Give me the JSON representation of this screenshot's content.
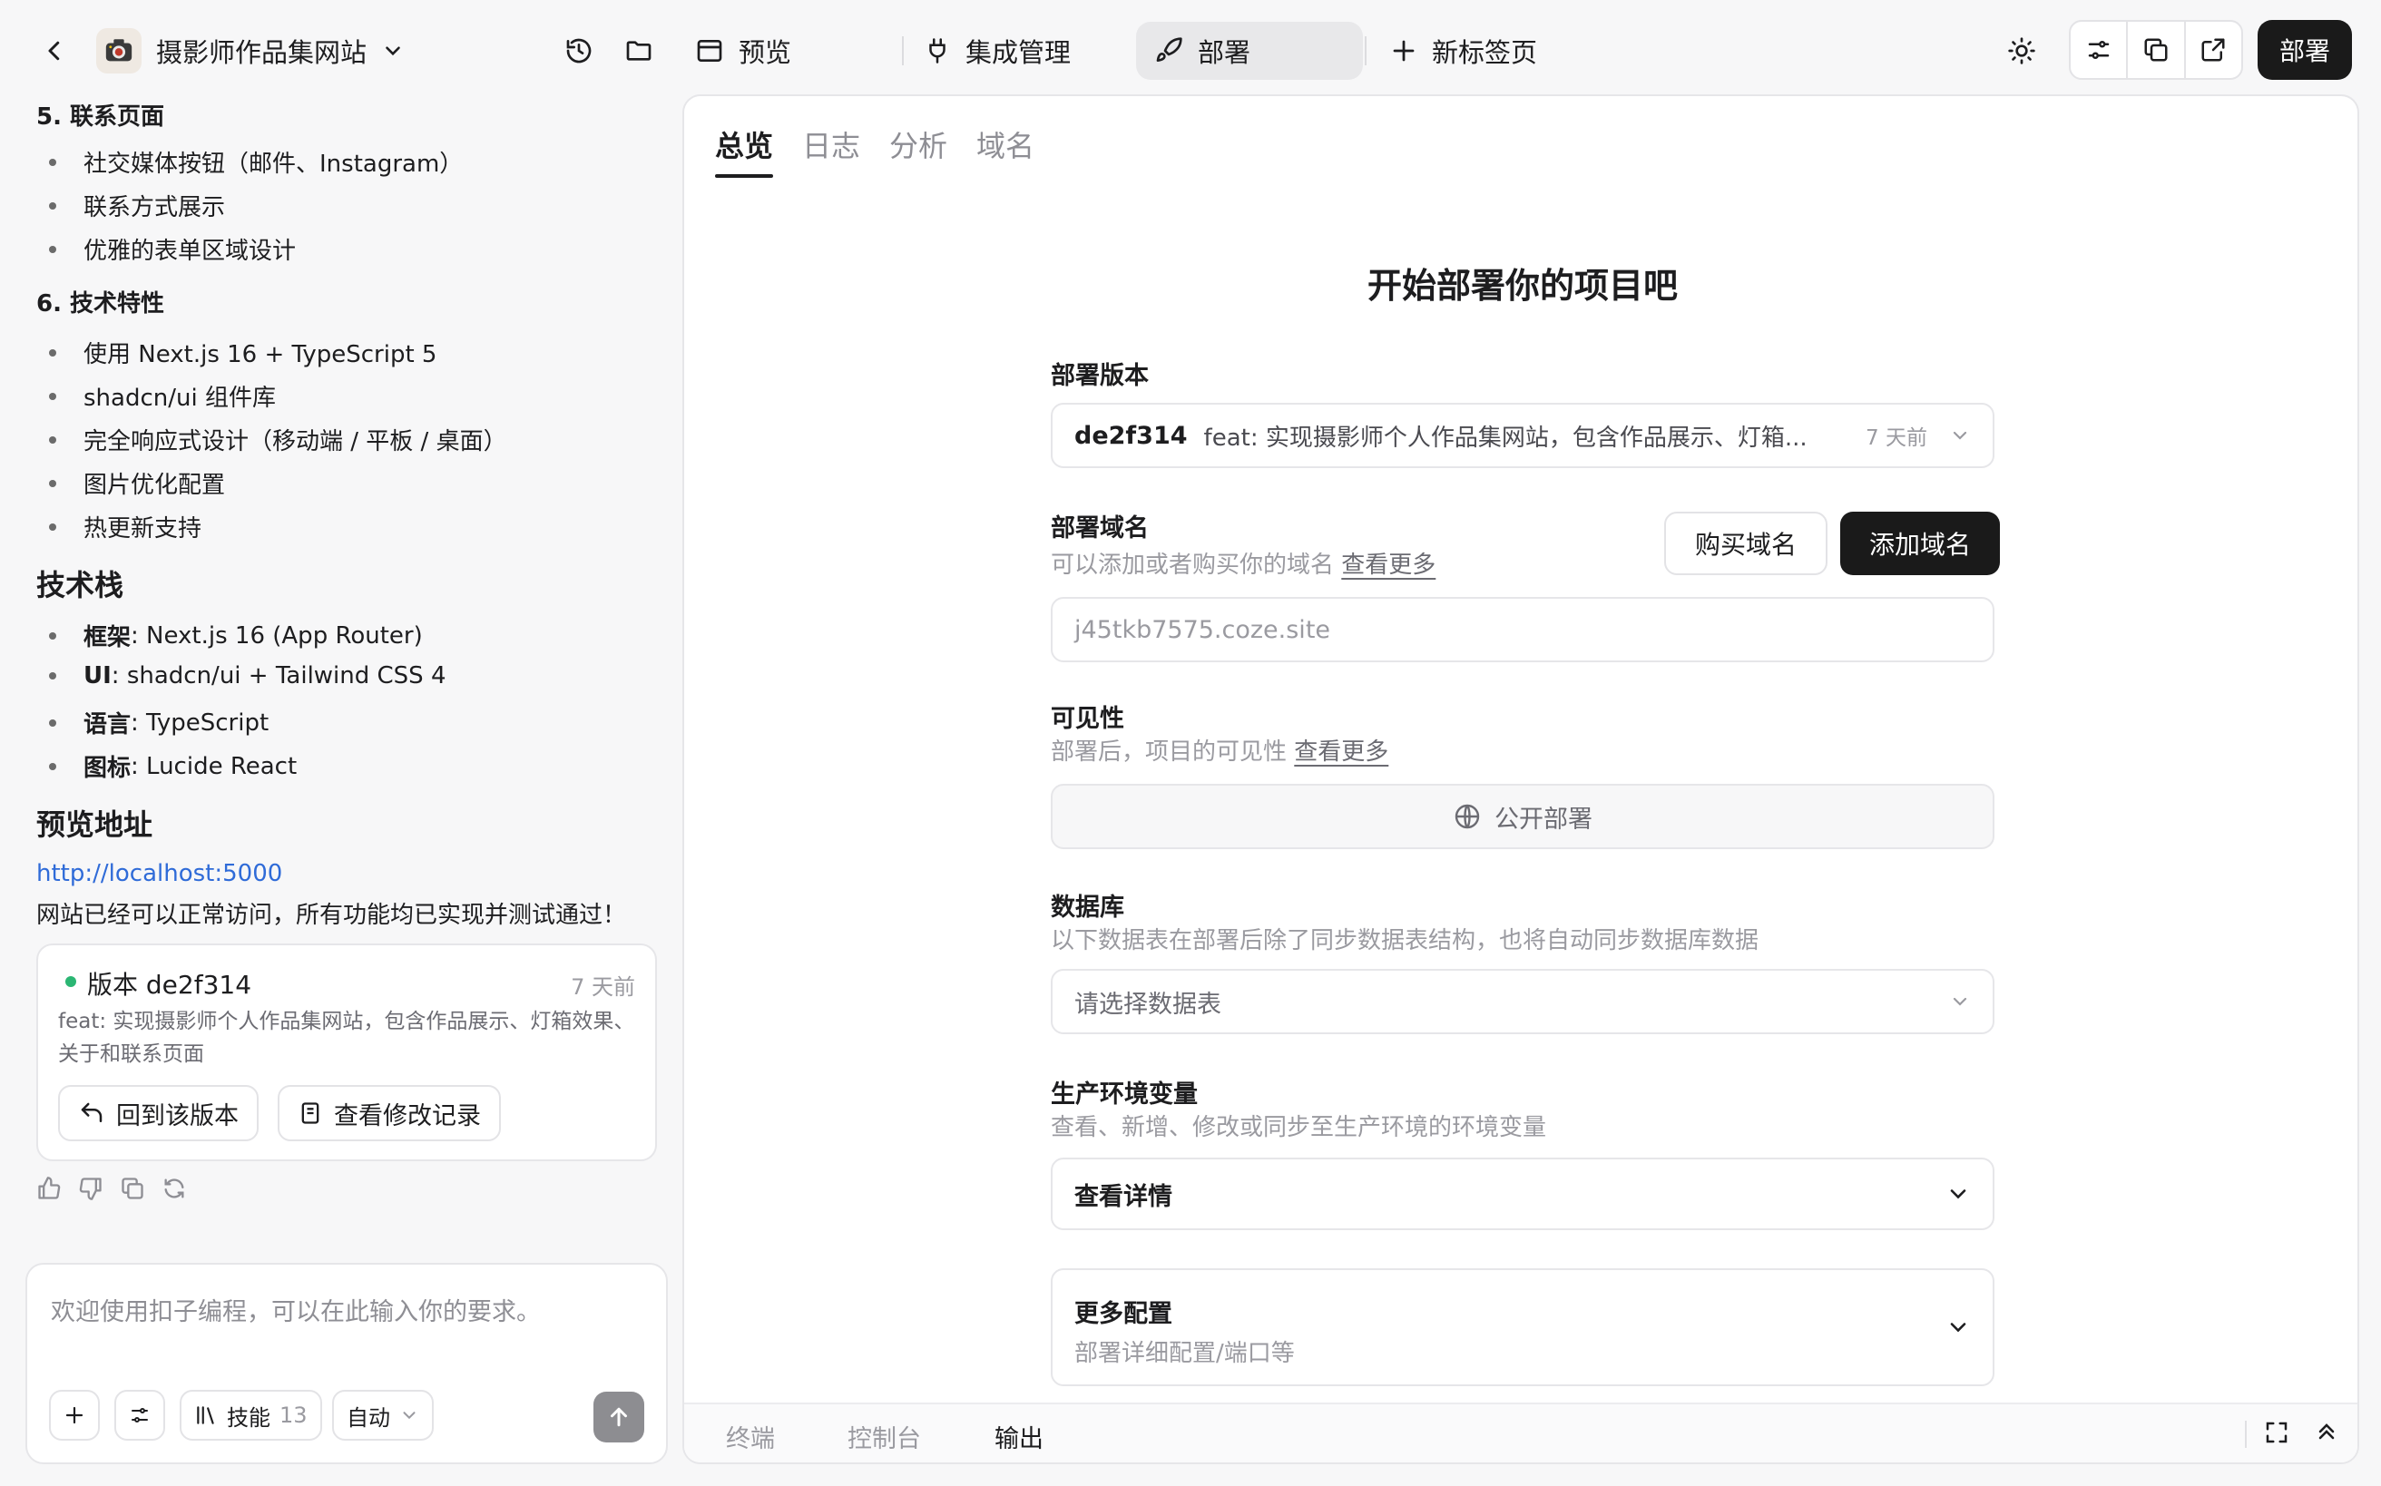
{
  "topbar": {
    "project_name": "摄影师作品集网站",
    "preview_label": "预览",
    "integration_label": "集成管理",
    "deploy_tab_label": "部署",
    "new_tab_label": "新标签页",
    "deploy_button": "部署"
  },
  "chat": {
    "sec5_title": "5. 联系页面",
    "sec5_items": [
      "社交媒体按钮（邮件、Instagram）",
      "联系方式展示",
      "优雅的表单区域设计"
    ],
    "sec6_title": "6. 技术特性",
    "sec6_items": [
      "使用 Next.js 16 + TypeScript 5",
      "shadcn/ui 组件库",
      "完全响应式设计（移动端 / 平板 / 桌面）",
      "图片优化配置",
      "热更新支持"
    ],
    "stack_title": "技术栈",
    "stack_items": [
      {
        "k": "框架",
        "v": ": Next.js 16 (App Router)"
      },
      {
        "k": "UI",
        "v": ": shadcn/ui + Tailwind CSS 4"
      },
      {
        "k": "语言",
        "v": ": TypeScript"
      },
      {
        "k": "图标",
        "v": ": Lucide React"
      }
    ],
    "preview_title": "预览地址",
    "preview_link": "http://localhost:5000",
    "preview_note": "网站已经可以正常访问，所有功能均已实现并测试通过！",
    "version_card": {
      "title": "版本 de2f314",
      "ago": "7 天前",
      "desc": "feat: 实现摄影师个人作品集网站，包含作品展示、灯箱效果、关于和联系页面",
      "revert_label": "回到该版本",
      "history_label": "查看修改记录"
    },
    "input": {
      "placeholder": "欢迎使用扣子编程，可以在此输入你的要求。",
      "skills_label": "技能",
      "skills_count": "13",
      "mode_label": "自动"
    }
  },
  "panel": {
    "tabs": [
      "总览",
      "日志",
      "分析",
      "域名"
    ],
    "title": "开始部署你的项目吧",
    "version_label": "部署版本",
    "version_hash": "de2f314",
    "version_msg": "feat: 实现摄影师个人作品集网站，包含作品展示、灯箱...",
    "version_ago": "7 天前",
    "domain_label": "部署域名",
    "domain_hint": "可以添加或者购买你的域名",
    "learn_more": "查看更多",
    "buy_domain": "购买域名",
    "add_domain": "添加域名",
    "domain_value": "j45tkb7575.coze.site",
    "visibility_label": "可见性",
    "visibility_hint": "部署后，项目的可见性",
    "visibility_value": "公开部署",
    "db_label": "数据库",
    "db_hint": "以下数据表在部署后除了同步数据表结构，也将自动同步数据库数据",
    "db_placeholder": "请选择数据表",
    "env_label": "生产环境变量",
    "env_hint": "查看、新增、修改或同步至生产环境的环境变量",
    "env_value": "查看详情",
    "more_label": "更多配置",
    "more_hint": "部署详细配置/端口等",
    "bottom_tabs": [
      "终端",
      "控制台",
      "输出"
    ]
  }
}
